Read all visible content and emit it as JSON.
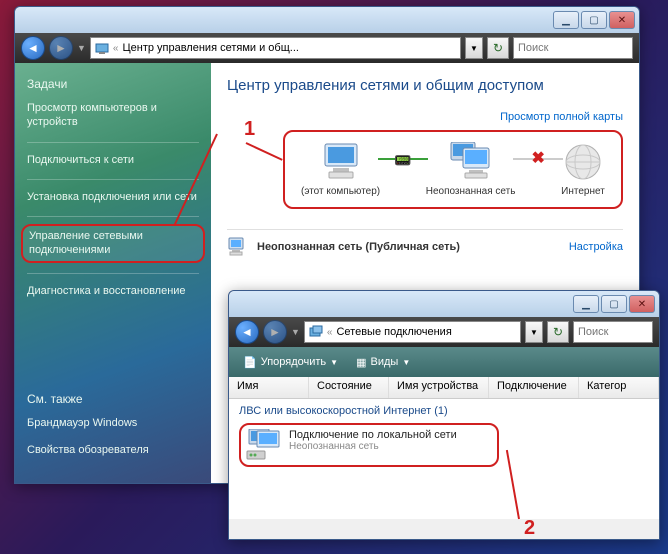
{
  "win1": {
    "breadcrumb_prefix": "«",
    "breadcrumb": "Центр управления сетями и общ...",
    "search_placeholder": "Поиск",
    "title": "Центр управления сетями и общим доступом",
    "map_link": "Просмотр полной карты",
    "sidebar": {
      "header": "Задачи",
      "items": [
        "Просмотр компьютеров и устройств",
        "Подключиться к сети",
        "Установка подключения или сети",
        "Управление сетевыми подключениями",
        "Диагностика и восстановление"
      ],
      "footer_header": "См. также",
      "footer": [
        "Брандмауэр Windows",
        "Свойства обозревателя"
      ]
    },
    "diagram": {
      "this_pc": "(этот компьютер)",
      "unknown": "Неопознанная сеть",
      "internet": "Интернет"
    },
    "netrow": {
      "label": "Неопознанная сеть (Публичная сеть)",
      "config": "Настройка"
    }
  },
  "win2": {
    "breadcrumb_prefix": "«",
    "breadcrumb": "Сетевые подключения",
    "search_placeholder": "Поиск",
    "toolbar": {
      "organize": "Упорядочить",
      "views": "Виды"
    },
    "columns": [
      "Имя",
      "Состояние",
      "Имя устройства",
      "Подключение",
      "Категор"
    ],
    "group": "ЛВС или высокоскоростной Интернет (1)",
    "item": {
      "name": "Подключение по локальной сети",
      "status": "Неопознанная сеть"
    }
  },
  "annotations": {
    "one": "1",
    "two": "2"
  }
}
